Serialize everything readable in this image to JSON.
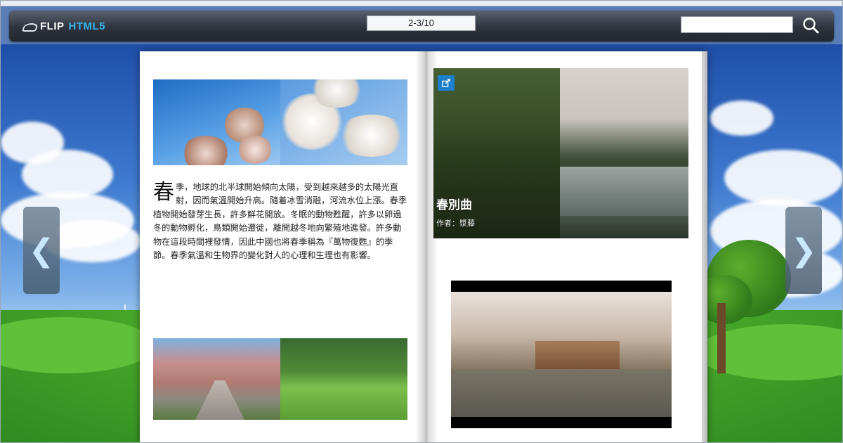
{
  "toolbar": {
    "logo_flip": "FLIP",
    "logo_html5": "HTML5",
    "page_indicator": "2-3/10",
    "search_placeholder": "",
    "search_icon": "search-icon"
  },
  "nav": {
    "prev_symbol": "❮",
    "next_symbol": "❯"
  },
  "book": {
    "left_page": {
      "dropcap": "春",
      "body": "季，地球的北半球開始傾向太陽，受到越來越多的太陽光直射，因而氣溫開始升高。隨着冰雪消融，河流水位上漲。春季植物開始發芽生長，許多鮮花開放。冬眠的動物甦醒，許多以卵過冬的動物孵化，鳥類開始遷徙，離開越冬地向繁殖地進發。許多動物在這段時間裡發情，因此中國也將春季稱為『萬物復甦』的季節。春季氣溫和生物界的變化對人的心理和生理也有影響。"
    },
    "right_page": {
      "video_title": "春別曲",
      "video_author": "作者：漿藤"
    }
  },
  "colors": {
    "accent": "#36b7f0",
    "toolbar_dark": "#2e333c"
  }
}
